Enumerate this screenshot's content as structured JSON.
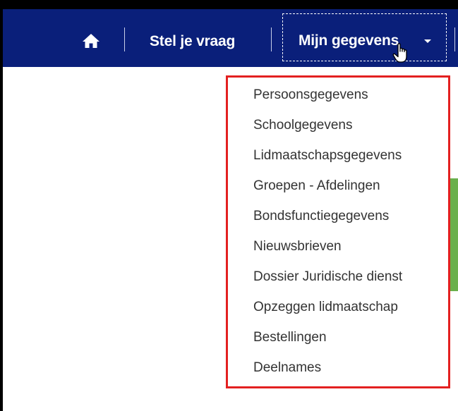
{
  "navbar": {
    "home_icon": "home-icon",
    "links": [
      "Stel je vraag"
    ],
    "dropdown_label": "Mijn gegevens",
    "colors": {
      "background": "#0a1f7a",
      "text": "#ffffff"
    }
  },
  "dropdown": {
    "items": [
      "Persoonsgegevens",
      "Schoolgegevens",
      "Lidmaatschapsgegevens",
      "Groepen - Afdelingen",
      "Bondsfunctiegegevens",
      "Nieuwsbrieven",
      "Dossier Juridische dienst",
      "Opzeggen lidmaatschap",
      "Bestellingen",
      "Deelnames"
    ],
    "highlight_border_color": "#e32020"
  }
}
